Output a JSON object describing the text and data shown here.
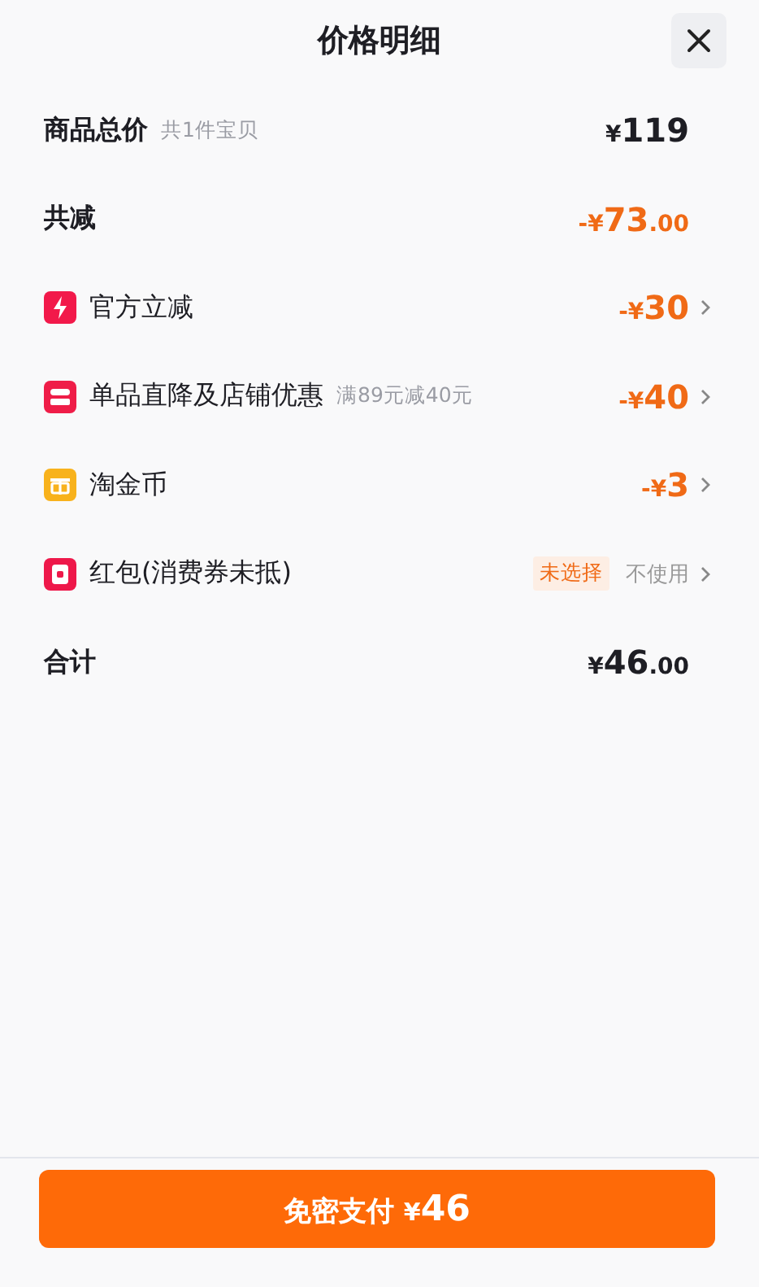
{
  "title": "价格明细",
  "rows": [
    {
      "kind": "summary",
      "label": "商品总价",
      "note": "共1件宝贝",
      "discounted": false,
      "prefix": "¥",
      "main": "119"
    },
    {
      "kind": "summary",
      "label": "共减",
      "discounted": true,
      "prefix": "-¥",
      "main": "73",
      "suffix": ".00"
    },
    {
      "kind": "instant",
      "label": "官方立减",
      "discounted": true,
      "prefix": "-¥",
      "main": "30"
    },
    {
      "kind": "store",
      "label": "单品直降及店铺优惠",
      "note": "满89元减40元",
      "discounted": true,
      "prefix": "-¥",
      "main": "40"
    },
    {
      "kind": "coins",
      "label": "淘金币",
      "discounted": true,
      "prefix": "-¥",
      "main": "3"
    },
    {
      "kind": "packet",
      "label": "红包(消费券未抵)",
      "tag": "未选择",
      "value": "不使用"
    },
    {
      "kind": "summary",
      "label": "合计",
      "discounted": false,
      "prefix": "¥",
      "main": "46",
      "suffix": ".00"
    }
  ],
  "pay_button": {
    "label": "免密支付",
    "prefix": "¥",
    "main": "46"
  }
}
